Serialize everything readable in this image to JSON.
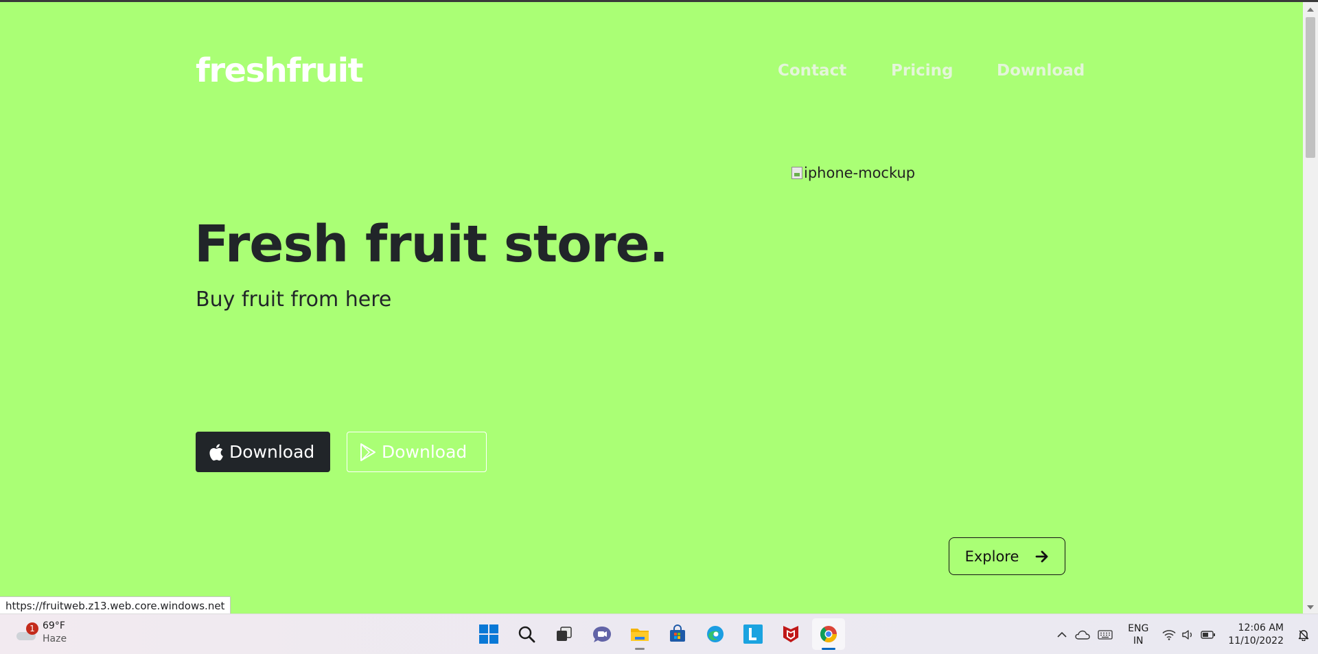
{
  "site": {
    "logo": "freshfruit",
    "nav": [
      "Contact",
      "Pricing",
      "Download"
    ],
    "mockup_alt": "iphone-mockup",
    "hero_title": "Fresh fruit store.",
    "hero_subtitle": "Buy fruit from here",
    "btn_apple_label": "Download",
    "btn_play_label": "Download",
    "explore_label": "Explore",
    "background_color": "#aaff75"
  },
  "browser": {
    "status_url": "https://fruitweb.z13.web.core.windows.net"
  },
  "taskbar": {
    "weather_temp": "69°F",
    "weather_condition": "Haze",
    "weather_badge": "1",
    "apps": [
      "start-icon",
      "search-icon",
      "task-view-icon",
      "teams-chat-icon",
      "file-explorer-icon",
      "microsoft-store-icon",
      "edge-icon",
      "l-app-icon",
      "mcafee-icon",
      "chrome-icon"
    ],
    "lang_line1": "ENG",
    "lang_line2": "IN",
    "time": "12:06 AM",
    "date": "11/10/2022"
  }
}
